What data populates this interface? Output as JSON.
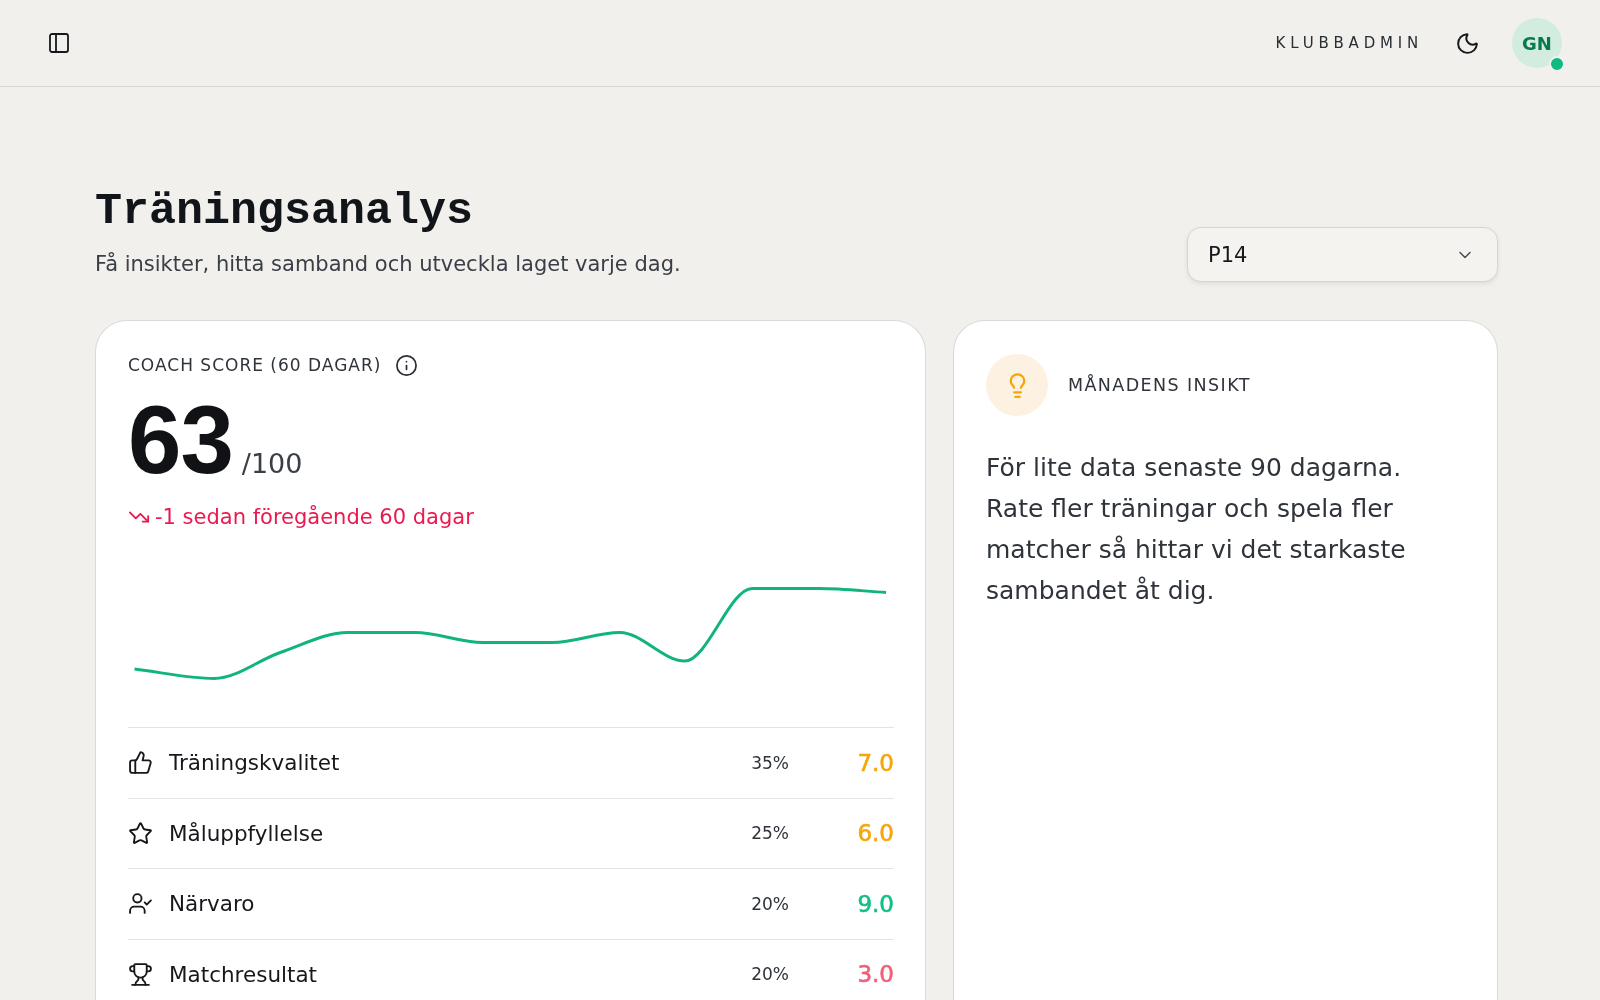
{
  "header": {
    "brand": "KLUBBADMIN",
    "avatar": {
      "initials": "GN",
      "online": true
    }
  },
  "page": {
    "title": "Träningsanalys",
    "subtitle": "Få insikter, hitta samband och utveckla laget varje dag.",
    "team_select": {
      "value": "P14"
    }
  },
  "coach_score": {
    "label": "COACH SCORE (60 DAGAR)",
    "score": "63",
    "max": "/100",
    "trend": {
      "negative": true,
      "text": "-1 sedan föregående 60 dagar"
    },
    "factors": [
      {
        "label": "Träningskvalitet",
        "weight": "35%",
        "score": "7.0",
        "color": "#f5a60a"
      },
      {
        "label": "Måluppfyllelse",
        "weight": "25%",
        "score": "6.0",
        "color": "#f5a60a"
      },
      {
        "label": "Närvaro",
        "weight": "20%",
        "score": "9.0",
        "color": "#12c085"
      },
      {
        "label": "Matchresultat",
        "weight": "20%",
        "score": "3.0",
        "color": "#f25f7a"
      }
    ]
  },
  "insight": {
    "title": "MÅNADENS INSIKT",
    "text": "För lite data senaste 90 dagarna. Rate fler träningar och spela fler matcher så hittar vi det starkaste sambandet åt dig."
  }
}
